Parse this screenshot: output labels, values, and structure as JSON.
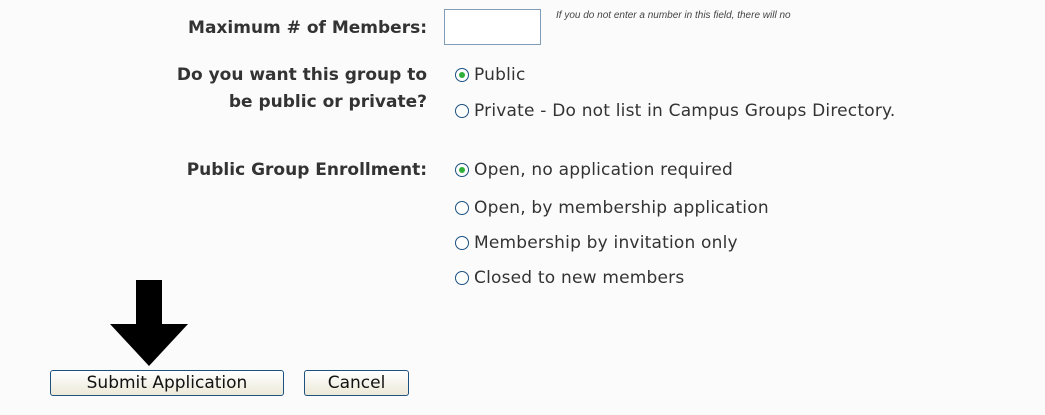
{
  "form": {
    "max_members": {
      "label": "Maximum # of Members:",
      "value": "",
      "hint": "If you do not enter a number in this field, there will no"
    },
    "visibility": {
      "label_line1": "Do you want this group to",
      "label_line2": "be public or private?",
      "options": [
        {
          "label": "Public",
          "checked": true
        },
        {
          "label": "Private - Do not list in Campus Groups Directory.",
          "checked": false
        }
      ]
    },
    "enrollment": {
      "label": "Public Group Enrollment:",
      "options": [
        {
          "label": "Open, no application required",
          "checked": true
        },
        {
          "label": "Open, by membership application",
          "checked": false
        },
        {
          "label": "Membership by invitation only",
          "checked": false
        },
        {
          "label": "Closed to new members",
          "checked": false
        }
      ]
    }
  },
  "actions": {
    "submit_label": "Submit Application",
    "cancel_label": "Cancel"
  },
  "annotation": {
    "arrow_icon": "down-arrow-icon",
    "arrow_color": "#000000"
  },
  "colors": {
    "radio_checked": "#2faf3a",
    "radio_border": "#1c5180",
    "label_text": "#333333"
  }
}
